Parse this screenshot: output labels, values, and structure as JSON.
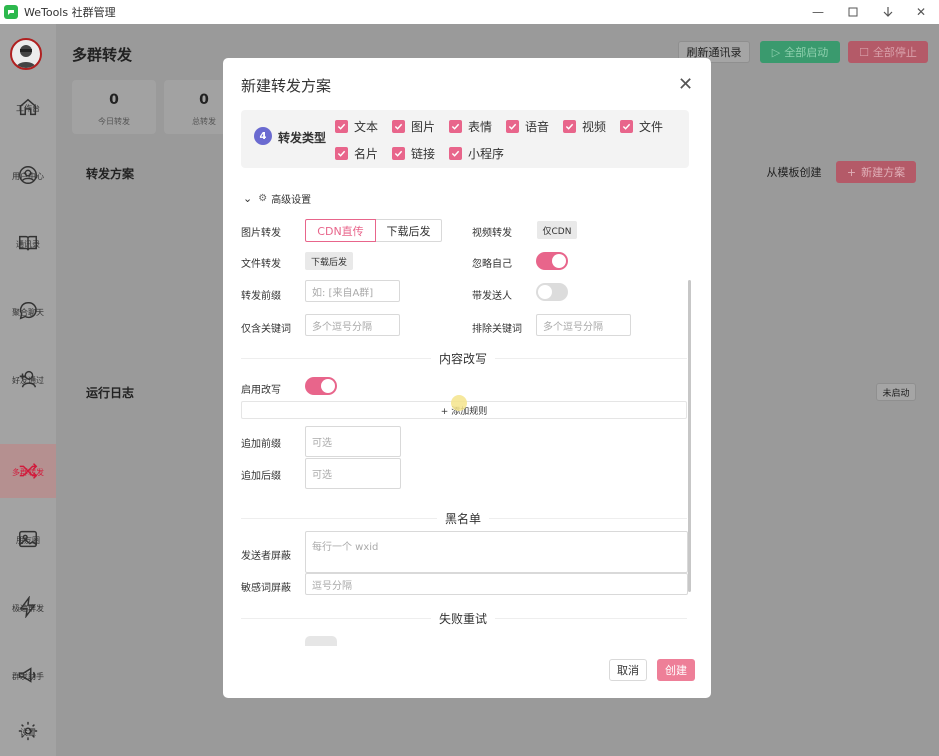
{
  "app": {
    "title": "WeTools 社群管理"
  },
  "window_controls": [
    "minimize-icon",
    "maximize-icon",
    "download-icon",
    "close-icon"
  ],
  "sidebar": {
    "items": [
      {
        "label": "工作台",
        "icon": "home-icon"
      },
      {
        "label": "用户中心",
        "icon": "user-circle-icon"
      },
      {
        "label": "通讯录",
        "icon": "book-icon"
      },
      {
        "label": "聚合聊天",
        "icon": "chat-icon"
      },
      {
        "label": "好友通过",
        "icon": "add-friend-icon"
      },
      {
        "label": "多群转发",
        "icon": "shuffle-icon",
        "active": true
      },
      {
        "label": "朋友圈",
        "icon": "image-icon"
      },
      {
        "label": "极速群发",
        "icon": "bolt-icon"
      },
      {
        "label": "群发助手",
        "icon": "megaphone-icon"
      },
      {
        "label": "设置",
        "icon": "gear-icon"
      }
    ]
  },
  "background": {
    "page_title": "多群转发",
    "refresh_label": "刷新通讯录",
    "start_all_label": "全部启动",
    "stop_all_label": "全部停止",
    "stats": [
      {
        "value": "0",
        "label": "今日转发"
      },
      {
        "value": "0",
        "label": "总转发"
      }
    ],
    "plans_title": "转发方案",
    "from_template_label": "从模板创建",
    "new_plan_label": "新建方案",
    "log_title": "运行日志",
    "log_status": "未启动"
  },
  "modal": {
    "title": "新建转发方案",
    "type_section": {
      "badge": "4",
      "title": "转发类型",
      "options": [
        {
          "label": "文本",
          "checked": true
        },
        {
          "label": "图片",
          "checked": true
        },
        {
          "label": "表情",
          "checked": true
        },
        {
          "label": "语音",
          "checked": true
        },
        {
          "label": "视频",
          "checked": true
        },
        {
          "label": "文件",
          "checked": true
        },
        {
          "label": "名片",
          "checked": true
        },
        {
          "label": "链接",
          "checked": true
        },
        {
          "label": "小程序",
          "checked": true
        }
      ]
    },
    "advanced_label": "高级设置",
    "image_forward": {
      "label": "图片转发",
      "options": [
        "CDN直传",
        "下载后发"
      ],
      "selected": "CDN直传"
    },
    "video_forward": {
      "label": "视频转发",
      "value": "仅CDN"
    },
    "file_forward": {
      "label": "文件转发",
      "value": "下载后发"
    },
    "ignore_self": {
      "label": "忽略自己",
      "on": true
    },
    "forward_prefix": {
      "label": "转发前缀",
      "placeholder": "如: [来自A群]"
    },
    "with_sender": {
      "label": "带发送人",
      "on": false
    },
    "include_keywords": {
      "label": "仅含关键词",
      "placeholder": "多个逗号分隔"
    },
    "exclude_keywords": {
      "label": "排除关键词",
      "placeholder": "多个逗号分隔"
    },
    "rewrite_title": "内容改写",
    "enable_rewrite": {
      "label": "启用改写",
      "on": true
    },
    "add_rule_label": "+ 添加规则",
    "append_prefix": {
      "label": "追加前缀",
      "placeholder": "可选"
    },
    "append_suffix": {
      "label": "追加后缀",
      "placeholder": "可选"
    },
    "blacklist_title": "黑名单",
    "sender_block": {
      "label": "发送者屏蔽",
      "placeholder": "每行一个 wxid"
    },
    "sensitive_block": {
      "label": "敏感词屏蔽",
      "placeholder": "逗号分隔"
    },
    "retry_title": "失败重试",
    "cancel_label": "取消",
    "create_label": "创建"
  },
  "colors": {
    "accent": "#e8658b",
    "badge": "#6a6ad0",
    "active_nav": "#d21a3b"
  }
}
